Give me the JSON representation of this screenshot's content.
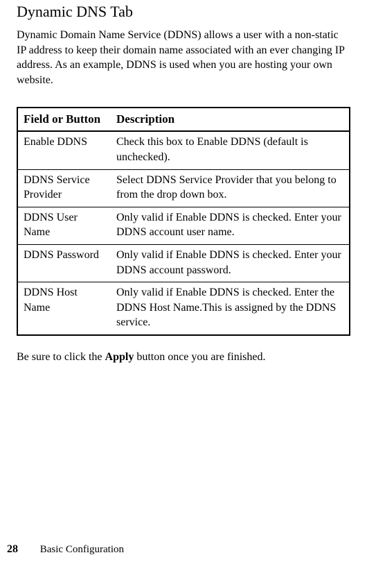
{
  "heading": "Dynamic DNS Tab",
  "intro": "Dynamic Domain Name Service (DDNS) allows a user with a non-static IP address to keep their domain name associated with an ever changing IP address. As an example, DDNS is used when you are hosting your own website.",
  "table": {
    "header_field": "Field or Button",
    "header_desc": "Description",
    "rows": [
      {
        "field": "Enable DDNS",
        "desc": "Check this box to Enable DDNS (default is unchecked)."
      },
      {
        "field": "DDNS Service Provider",
        "desc": "Select DDNS Service Provider that you belong to from the drop down box."
      },
      {
        "field": "DDNS User Name",
        "desc": "Only valid if Enable DDNS is checked. Enter your DDNS account user name."
      },
      {
        "field": "DDNS Password",
        "desc": "Only valid if Enable DDNS is checked. Enter your DDNS account password."
      },
      {
        "field": "DDNS Host Name",
        "desc": "Only valid if Enable DDNS is checked. Enter the DDNS Host Name.This is assigned by the DDNS service."
      }
    ]
  },
  "closing_pre": "Be sure to click the ",
  "closing_bold": "Apply",
  "closing_post": " button once you are finished.",
  "footer": {
    "pagenum": "28",
    "section": "Basic Configuration"
  }
}
